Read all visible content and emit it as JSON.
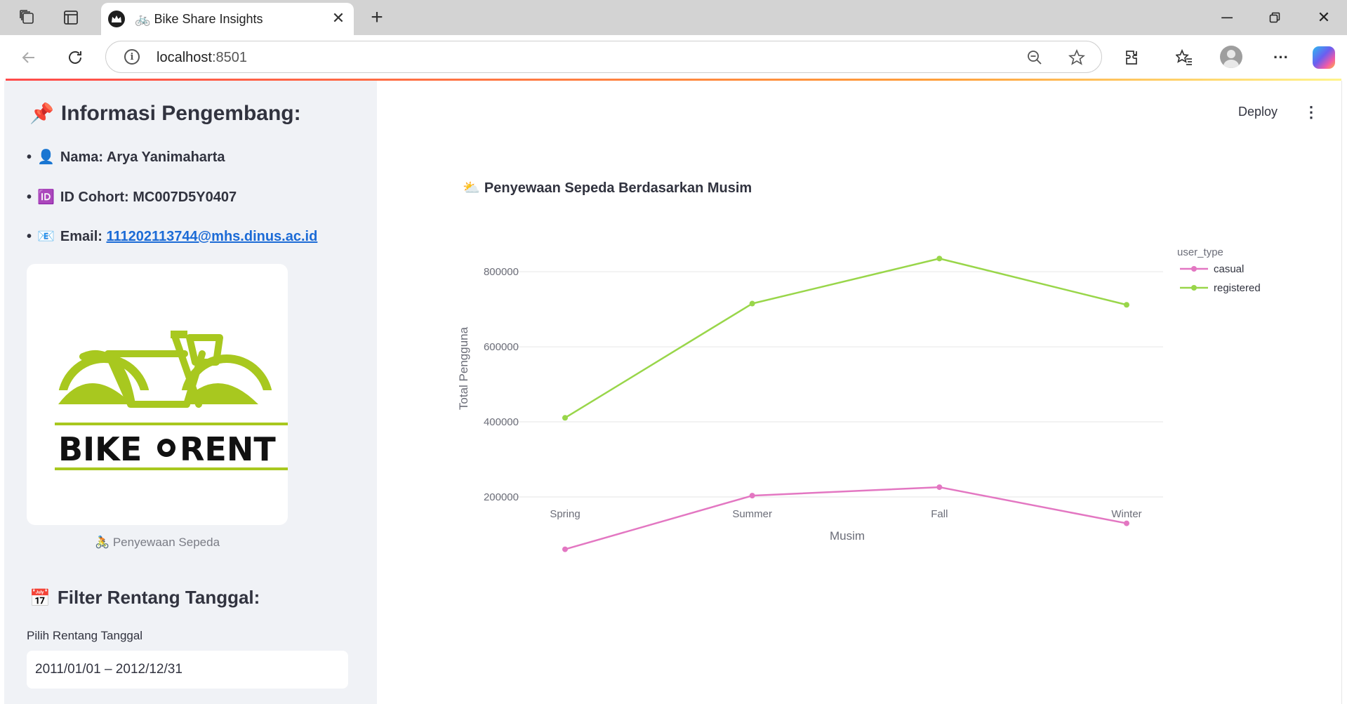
{
  "browser": {
    "tab_title": "Bike Share Insights",
    "tab_emoji": "🚲",
    "url_host": "localhost",
    "url_port": ":8501"
  },
  "sidebar": {
    "dev_heading": "Informasi Pengembang:",
    "dev_heading_emoji": "📌",
    "items": [
      {
        "emoji": "👤",
        "label": "Nama: Arya Yanimaharta"
      },
      {
        "emoji": "🆔",
        "label": "ID Cohort: MC007D5Y0407"
      },
      {
        "emoji": "📧",
        "label": "Email: ",
        "link": "111202113744@mhs.dinus.ac.id"
      }
    ],
    "logo": {
      "word_left": "BIKE",
      "word_right": "RENT",
      "color": "#a8c81f"
    },
    "logo_caption": "🚴 Penyewaan Sepeda",
    "filter_heading": "Filter Rentang Tanggal:",
    "filter_heading_emoji": "📅",
    "date_label": "Pilih Rentang Tanggal",
    "date_value": "2011/01/01 – 2012/12/31"
  },
  "main": {
    "deploy_label": "Deploy",
    "chart_title": "Penyewaan Sepeda Berdasarkan Musim",
    "chart_title_emoji": "⛅"
  },
  "chart_data": {
    "type": "line",
    "categories": [
      "Spring",
      "Summer",
      "Fall",
      "Winter"
    ],
    "series": [
      {
        "name": "casual",
        "color": "#e377c2",
        "values": [
          60622,
          203522,
          226091,
          129782
        ]
      },
      {
        "name": "registered",
        "color": "#99d64a",
        "values": [
          410726,
          715067,
          835038,
          711831
        ]
      }
    ],
    "xlabel": "Musim",
    "ylabel": "Total Pengguna",
    "legend_title": "user_type",
    "yticks": [
      200000,
      400000,
      600000,
      800000
    ],
    "ylim": [
      0,
      860000
    ],
    "grid": true,
    "legend_position": "top-right"
  }
}
